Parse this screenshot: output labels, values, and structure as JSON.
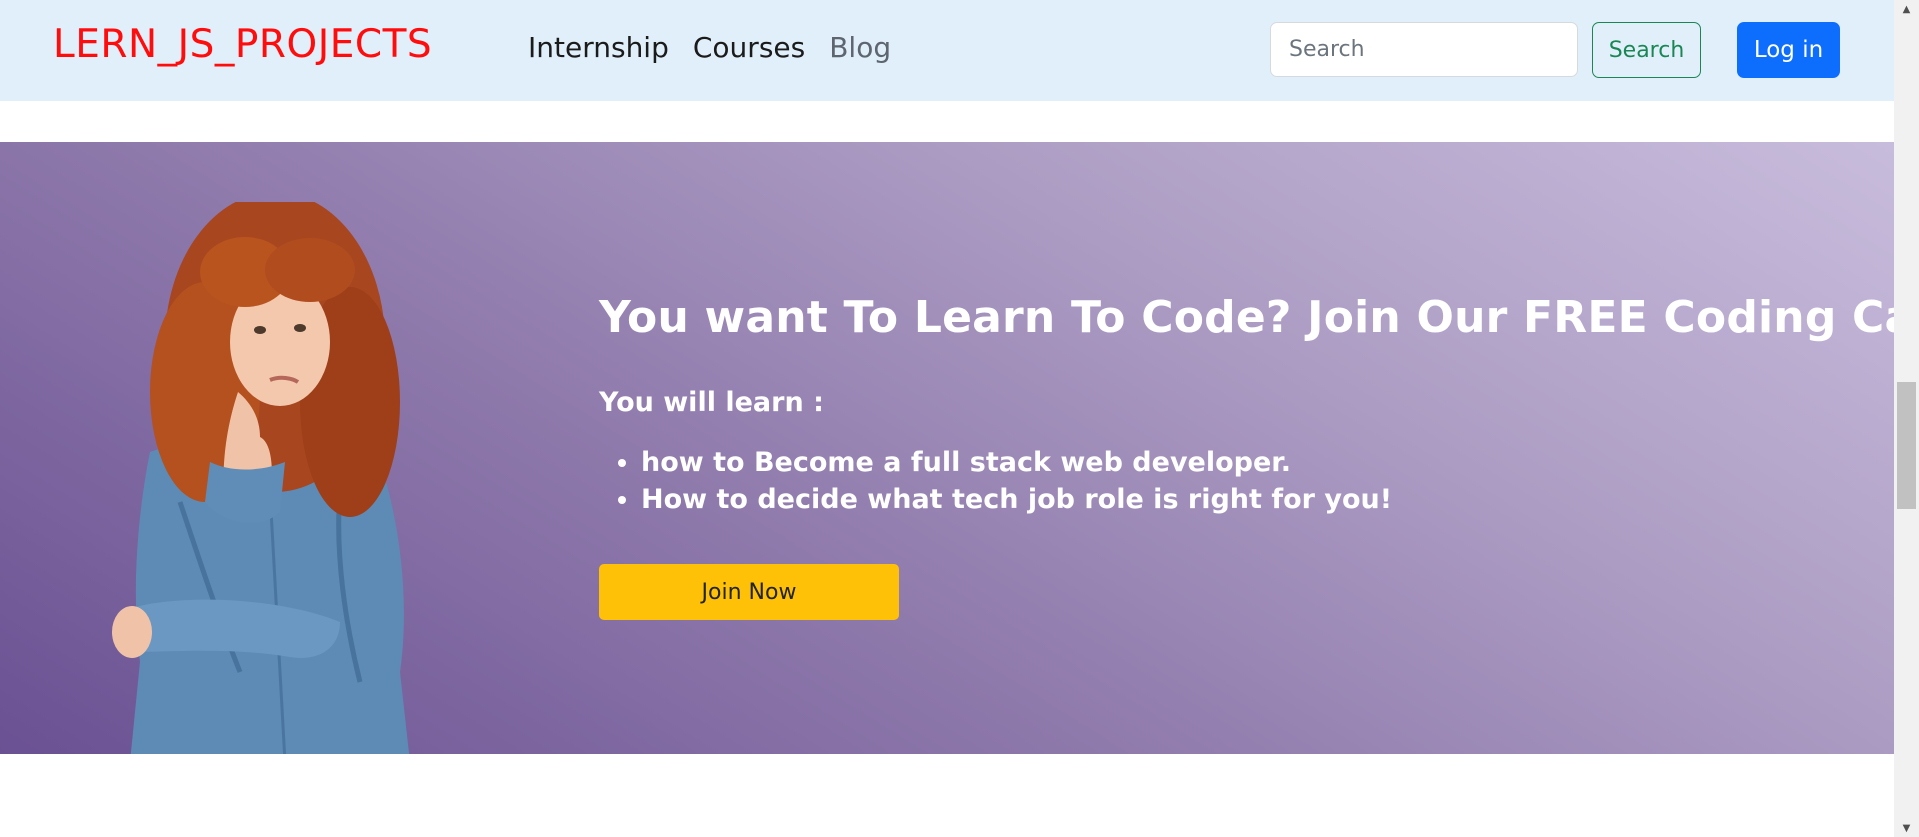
{
  "navbar": {
    "brand": "LERN_JS_PROJECTS",
    "links": [
      {
        "label": "Internship"
      },
      {
        "label": "Courses"
      },
      {
        "label": "Blog"
      }
    ],
    "search": {
      "placeholder": "Search",
      "value": "",
      "button_label": "Search"
    },
    "login_label": "Log in"
  },
  "hero": {
    "heading": "You want To Learn To Code? Join Our FREE Coding Camp!",
    "subheading": "You will learn :",
    "bullets": [
      "how to Become a full stack web developer.",
      "How to decide what tech job role is right for you!"
    ],
    "cta_label": "Join Now",
    "colors": {
      "gradient_start": "#6a5193",
      "gradient_end": "#c8bcdc",
      "cta": "#ffc107"
    }
  },
  "colors": {
    "brand": "#ff0d0d",
    "navbar_bg": "#e1effb",
    "search_outline": "#198754",
    "login_bg": "#0d6efd"
  },
  "icons": {
    "scroll_up": "scroll-up-arrow-icon",
    "scroll_down": "scroll-down-arrow-icon",
    "hero_image": "thinking-woman-illustration"
  }
}
